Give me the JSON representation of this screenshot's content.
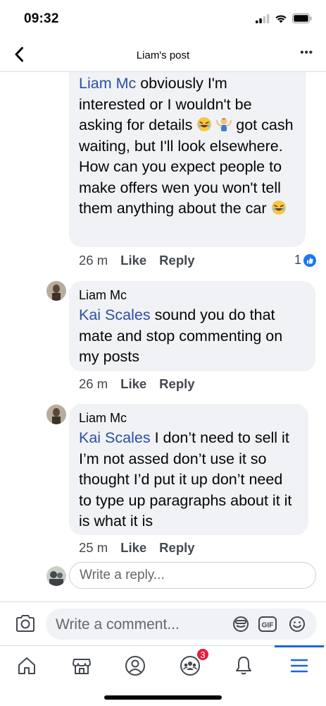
{
  "status_bar": {
    "time": "09:32"
  },
  "header": {
    "title": "Liam's post",
    "more": "•••"
  },
  "comments": [
    {
      "mention": "Liam Mc",
      "text_a": " obviously I'm interested or I wouldn't be asking for details ",
      "text_b": " got cash waiting, but I'll look elsewhere. How can you expect people to make offers wen you won't tell them anything about the car ",
      "time": "26 m",
      "like": "Like",
      "reply": "Reply",
      "reaction_count": "1"
    },
    {
      "author": "Liam Mc",
      "mention": "Kai Scales",
      "text": "  sound you do that mate and stop commenting on my posts",
      "time": "26 m",
      "like": "Like",
      "reply": "Reply"
    },
    {
      "author": "Liam Mc",
      "mention": "Kai Scales",
      "text": " I don’t need to sell it I’m not assed don’t use it so thought I’d put it up don’t need to type up paragraphs about it it is what it is",
      "time": "25 m",
      "like": "Like",
      "reply": "Reply"
    }
  ],
  "reply_box": {
    "placeholder": "Write a reply..."
  },
  "composer": {
    "placeholder": "Write a comment..."
  },
  "tabbar": {
    "groups_badge": "3"
  },
  "colors": {
    "accent": "#1a66e0",
    "mention": "#2c4fa3",
    "bubble": "#f0f2f5",
    "badge": "#e41e3f"
  }
}
